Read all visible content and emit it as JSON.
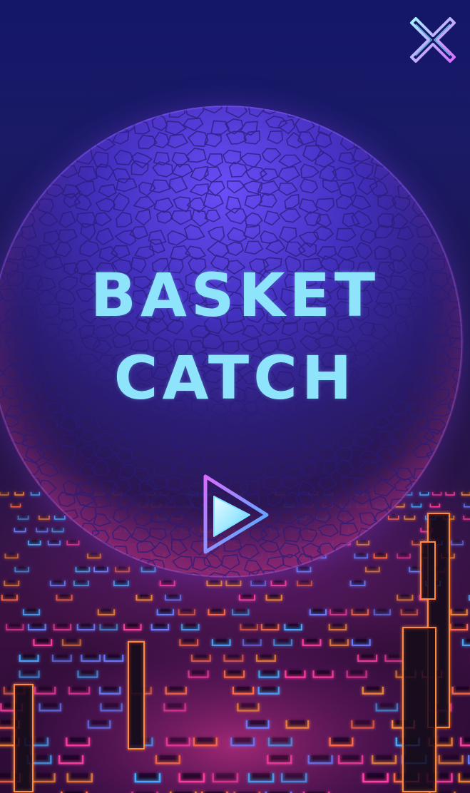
{
  "game": {
    "title_line_1": "BASKET",
    "title_line_2": "CATCH"
  },
  "controls": {
    "play_icon": "play-icon",
    "close_icon": "close-icon"
  },
  "colors": {
    "title": "#8ee4fb",
    "orb_top": "#6e50ff",
    "orb_bottom": "#c83c96",
    "neon_orange": "#ff8a3a",
    "neon_blue": "#4aa8ff",
    "neon_pink": "#ff3fa5",
    "icon_cyan": "#7fe3ff",
    "icon_magenta": "#d86bff"
  }
}
